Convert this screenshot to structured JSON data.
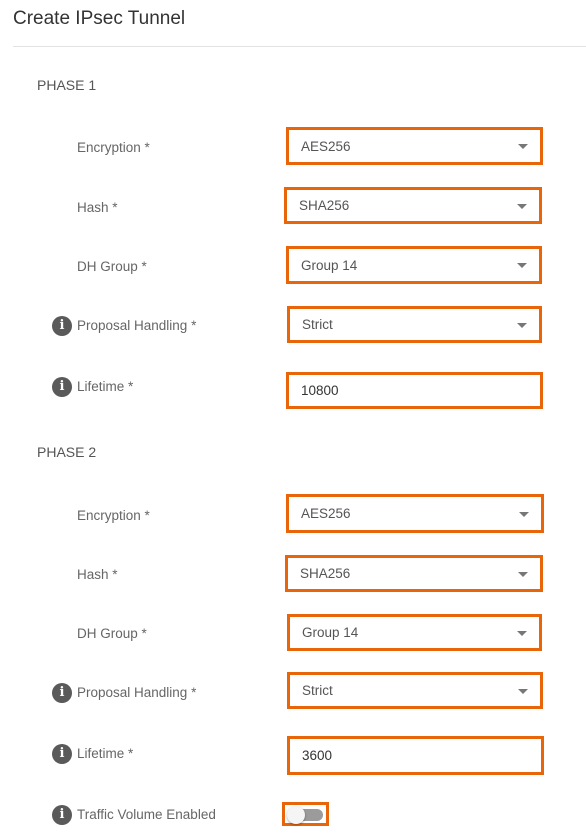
{
  "header": {
    "title": "Create IPsec Tunnel"
  },
  "phase1": {
    "heading": "PHASE 1",
    "encryption": {
      "label": "Encryption *",
      "value": "AES256"
    },
    "hash": {
      "label": "Hash *",
      "value": "SHA256"
    },
    "dh_group": {
      "label": "DH Group *",
      "value": "Group 14"
    },
    "proposal_handling": {
      "label": "Proposal Handling *",
      "value": "Strict",
      "icon": "info-icon"
    },
    "lifetime": {
      "label": "Lifetime *",
      "value": "10800",
      "icon": "info-icon"
    }
  },
  "phase2": {
    "heading": "PHASE 2",
    "encryption": {
      "label": "Encryption *",
      "value": "AES256"
    },
    "hash": {
      "label": "Hash *",
      "value": "SHA256"
    },
    "dh_group": {
      "label": "DH Group *",
      "value": "Group 14"
    },
    "proposal_handling": {
      "label": "Proposal Handling *",
      "value": "Strict",
      "icon": "info-icon"
    },
    "lifetime": {
      "label": "Lifetime *",
      "value": "3600",
      "icon": "info-icon"
    },
    "traffic_volume": {
      "label": "Traffic Volume Enabled",
      "enabled": false,
      "icon": "info-icon"
    }
  },
  "info_glyph": "i",
  "colors": {
    "highlight": "#e8650a",
    "toggle_off": "#9b9b9b",
    "info_icon": "#5a5a5a"
  }
}
